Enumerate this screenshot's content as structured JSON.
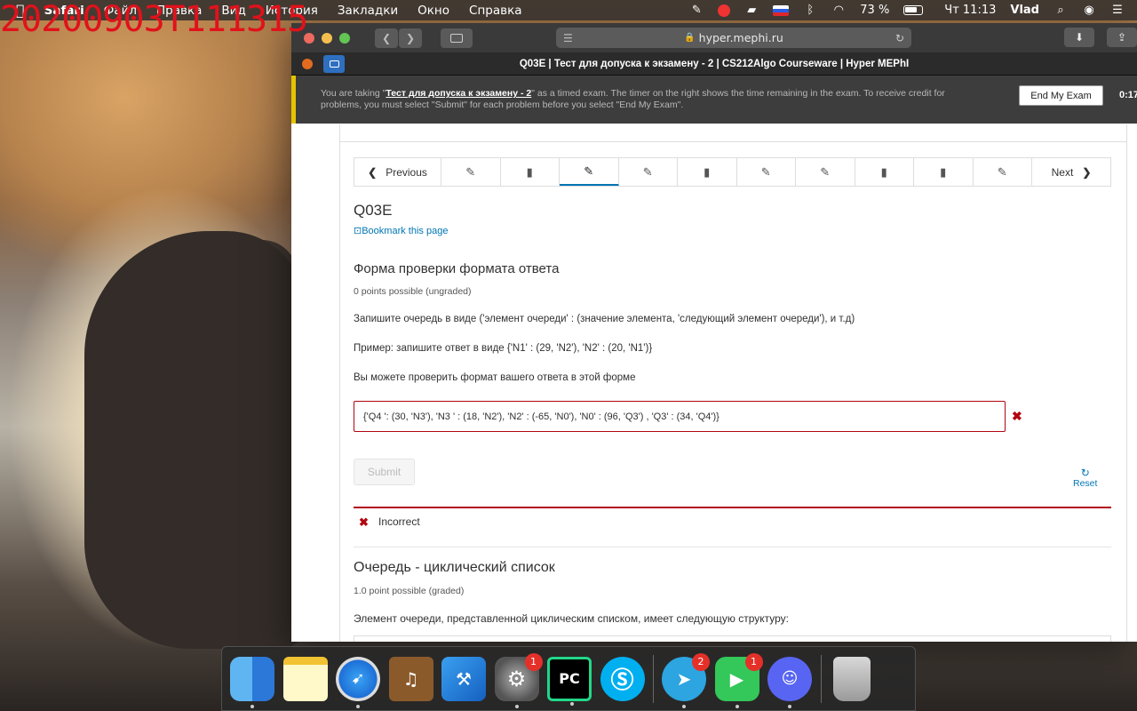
{
  "watermark": "20200903T111315",
  "menubar": {
    "apple": "",
    "items": [
      "Safari",
      "Файл",
      "Правка",
      "Вид",
      "История",
      "Закладки",
      "Окно",
      "Справка"
    ],
    "battery": "73 %",
    "clock": "Чт 11:13",
    "user": "Vlad"
  },
  "browser": {
    "url": "hyper.mephi.ru",
    "tab_title": "Q03E | Тест для допуска к экзамену - 2 | CS212Algo Courseware | Hyper MEPhI"
  },
  "exam_banner": {
    "prefix": "You are taking \"",
    "exam_name": "Тест для допуска к экзамену - 2",
    "suffix": "\" as a timed exam. The timer on the right shows the time remaining in the exam. To receive credit for problems, you must select \"Submit\" for each problem before you select \"End My Exam\".",
    "end_button": "End My Exam",
    "timer": "0:17:"
  },
  "sequence_nav": {
    "previous": "Previous",
    "next": "Next",
    "units": [
      "edit",
      "book",
      "edit",
      "edit",
      "book",
      "edit",
      "edit",
      "book",
      "book",
      "edit"
    ],
    "active_index": 2
  },
  "page": {
    "title": "Q03E",
    "bookmark": "Bookmark this page"
  },
  "problem1": {
    "title": "Форма проверки формата ответа",
    "points": "0 points possible (ungraded)",
    "line1": "Запишите очередь в виде ('элемент очереди' : (значение элемента, 'следующий элемент очереди'), и т.д)",
    "line2": "Пример: запишите ответ в виде {'N1' : (29, 'N2'), 'N2' : (20, 'N1')}",
    "line3": "Вы можете проверить формат вашего ответа в этой форме",
    "answer_value": "{'Q4 ': (30, 'N3'), 'N3 ' : (18, 'N2'), 'N2' : (-65, 'N0'), 'N0' : (96, 'Q3') , 'Q3' : (34, 'Q4')}",
    "submit": "Submit",
    "reset": "Reset",
    "status": "Incorrect"
  },
  "problem2": {
    "title": "Очередь - циклический список",
    "points": "1.0 point possible (graded)",
    "line1": "Элемент очереди, представленной циклическим списком, имеет следующую структуру:"
  },
  "dock": {
    "apps": [
      {
        "name": "finder",
        "badge": ""
      },
      {
        "name": "notes",
        "badge": ""
      },
      {
        "name": "safari",
        "badge": ""
      },
      {
        "name": "garageband",
        "badge": ""
      },
      {
        "name": "xcode",
        "badge": ""
      },
      {
        "name": "system-preferences",
        "badge": "1"
      },
      {
        "name": "pycharm",
        "badge": ""
      },
      {
        "name": "skype",
        "badge": ""
      },
      {
        "name": "telegram",
        "badge": "2"
      },
      {
        "name": "facetime",
        "badge": "1"
      },
      {
        "name": "discord",
        "badge": ""
      },
      {
        "name": "trash",
        "badge": ""
      }
    ],
    "pycharm_label": "PC"
  },
  "colors": {
    "incorrect": "#b20610",
    "link": "#0075b4",
    "banner_accent": "#e4c300"
  }
}
